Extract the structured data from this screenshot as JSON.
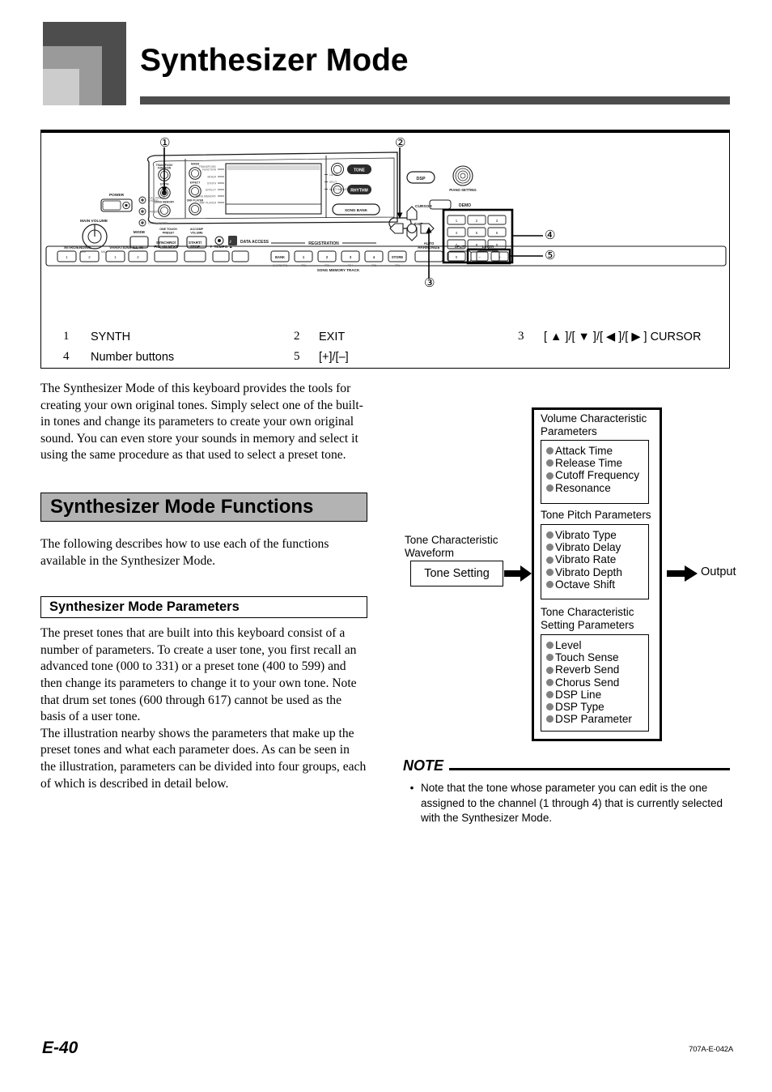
{
  "header": {
    "chapter_title": "Synthesizer Mode",
    "deco_colors": [
      "#4d4d4d",
      "#9a9a9a",
      "#cccccc"
    ],
    "rule_color": "#4d4d4d"
  },
  "figure": {
    "callouts": [
      "①",
      "②",
      "③",
      "④",
      "⑤"
    ],
    "legend": [
      {
        "index": "1",
        "label": "SYNTH"
      },
      {
        "index": "2",
        "label": "EXIT"
      },
      {
        "index": "3",
        "label": "[ ▲ ]/[ ▼ ]/[ ◀ ]/[ ▶ ] CURSOR"
      },
      {
        "index": "4",
        "label": "Number buttons"
      },
      {
        "index": "5",
        "label": "[+]/[–]"
      }
    ],
    "panel_labels": {
      "power": "POWER",
      "main_volume": "MAIN VOLUME",
      "min": "MIN",
      "max": "MAX",
      "mode": "MODE",
      "one_touch_preset": "ONE TOUCH\nPRESET",
      "accomp_volume": "ACCOMP\nVOLUME",
      "data_access": "DATA ACCESS",
      "intro_ending": "INTRO/ENDING",
      "variation_fill_in": "VARIATION/FILL-IN",
      "synchro_fill_in_next": "SYNCHRO/\nFILL-IN NEXT",
      "start_stop": "START/\nSTOP",
      "tempo": "TEMPO",
      "registration": "REGISTRATION",
      "bank": "BANK",
      "store": "STORE",
      "song_memory_track": "SONG MEMORY TRACK",
      "auto_harmonize": "AUTO\nHARMONIZE",
      "split": "SPLIT",
      "layer": "LAYER",
      "transpose_function": "TRANSPOSE/\nFUNCTION",
      "mixer": "MIXER",
      "synth": "SYNTH",
      "effect": "EFFECT",
      "song_memory": "SONG MEMORY",
      "smf_player": "SMF PLAYER",
      "tone": "TONE",
      "rhythm": "RHYTHM",
      "song_bank": "SONG BANK",
      "dsp": "DSP",
      "piano_setting": "PIANO SETTING",
      "demo": "DEMO",
      "cursor": "CURSOR",
      "exit": "EXIT",
      "yes": "YES",
      "no": "NO",
      "full_range_chord": "FULL RANGE\nCHORD",
      "fingered": "FINGERED",
      "casio_chord": "CASIO CHORD",
      "lcd_right_items": [
        "LAYER",
        "SPLIT",
        "AUTO HARMONIZE"
      ]
    }
  },
  "body": {
    "intro": "The Synthesizer Mode of this keyboard provides the tools for creating your own original tones. Simply select one of the built-in tones and change its parameters to create your own original sound. You can even store your sounds in memory and select it using the same procedure as that used to select a preset tone.",
    "section_heading": "Synthesizer Mode Functions",
    "section_intro": "The following describes how to use each of the functions available in the Synthesizer Mode.",
    "subsection_heading": "Synthesizer Mode Parameters",
    "subsection_p1": "The preset tones that are built into this keyboard consist of a number of parameters. To create a user tone, you first recall an advanced tone (000 to 331) or a preset tone (400 to 599) and then change its parameters to change it to your own tone. Note that drum set tones (600 through 617) cannot be used as the basis of a user tone.",
    "subsection_p2": "The illustration nearby shows the parameters that make up the preset tones and what each parameter does. As can be seen in the illustration, parameters can be divided into four groups, each of which is described in detail below."
  },
  "diagram": {
    "input_label": "Tone Characteristic\nWaveform",
    "input_box": "Tone Setting",
    "output_label": "Output",
    "groups": [
      {
        "title": "Volume Characteristic\nParameters",
        "items": [
          "Attack Time",
          "Release Time",
          "Cutoff Frequency",
          "Resonance"
        ]
      },
      {
        "title": "Tone Pitch Parameters",
        "items": [
          "Vibrato Type",
          "Vibrato Delay",
          "Vibrato Rate",
          "Vibrato Depth",
          "Octave Shift"
        ]
      },
      {
        "title": "Tone Characteristic\nSetting Parameters",
        "items": [
          "Level",
          "Touch Sense",
          "Reverb Send",
          "Chorus Send",
          "DSP Line",
          "DSP Type",
          "DSP Parameter"
        ]
      }
    ],
    "bullet_color": "#808080"
  },
  "note": {
    "title": "NOTE",
    "bullet": "•",
    "items": [
      "Note that the tone whose parameter you can edit is the one assigned to the channel (1 through 4) that is currently selected with the Synthesizer Mode."
    ]
  },
  "footer": {
    "page_number": "E-40",
    "doc_code": "707A-E-042A"
  }
}
